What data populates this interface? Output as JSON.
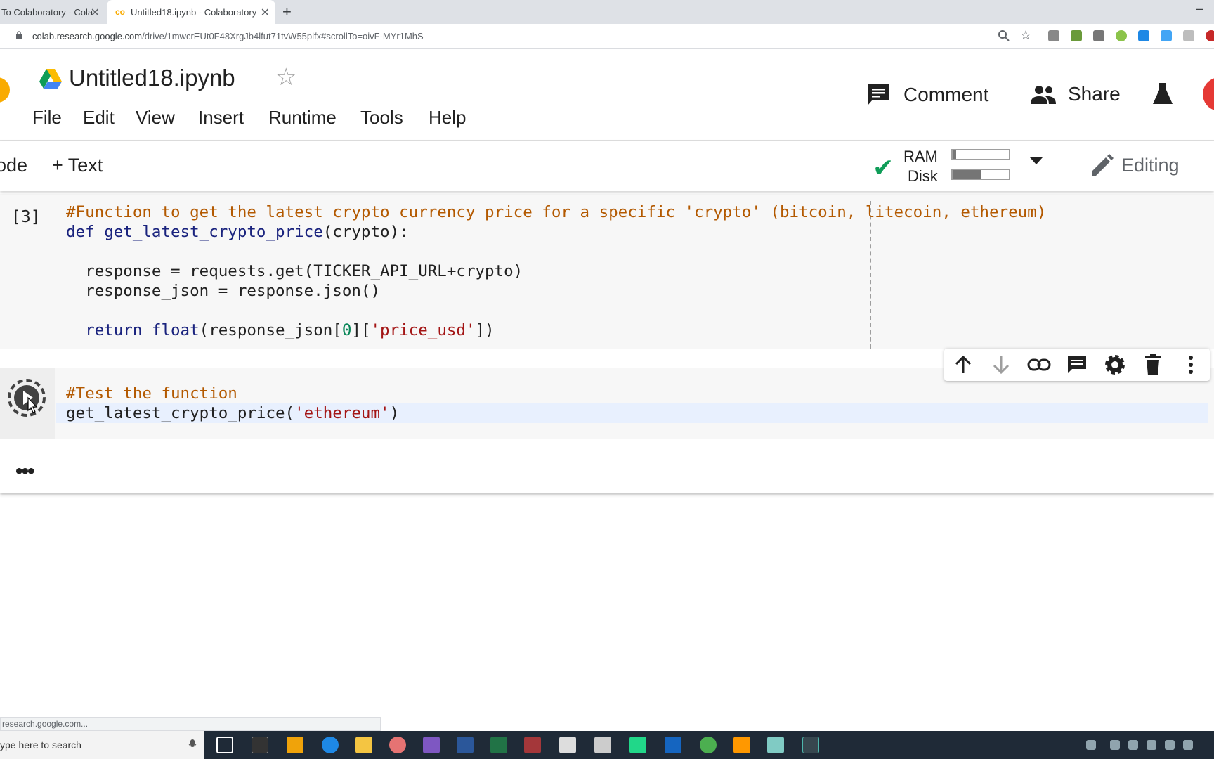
{
  "browser": {
    "tabs": [
      {
        "title": "To Colaboratory - Cola"
      },
      {
        "title": "Untitled18.ipynb - Colaboratory",
        "favicon": "co"
      }
    ],
    "url_host": "colab.research.google.com",
    "url_path": "/drive/1mwcrEUt0F48XrgJb4lfut71tvW55plfx#scrollTo=oivF-MYr1MhS",
    "new_tab_symbol": "+",
    "minimize_symbol": "–"
  },
  "header": {
    "title": "Untitled18.ipynb",
    "menu": [
      "File",
      "Edit",
      "View",
      "Insert",
      "Runtime",
      "Tools",
      "Help"
    ],
    "comment_label": "Comment",
    "share_label": "Share"
  },
  "toolbar": {
    "add_code_label": "ode",
    "add_text_label": "+ Text",
    "ram_label": "RAM",
    "disk_label": "Disk",
    "ram_usage": 0.06,
    "disk_usage": 0.5,
    "editing_label": "Editing"
  },
  "cells": {
    "cell1": {
      "exec_count": "[3]",
      "line1_comment": "#Function to get the latest crypto currency price for a specific 'crypto' (bitcoin, litecoin, ethereum)",
      "line2_kw": "def",
      "line2_fn": "get_latest_crypto_price",
      "line2_rest": "(crypto):",
      "line4": "  response = requests.get(TICKER_API_URL+crypto)",
      "line5": "  response_json = response.json()",
      "line7_kw": "  return",
      "line7_bi": "float",
      "line7_a": "(response_json[",
      "line7_num": "0",
      "line7_b": "][",
      "line7_str": "'price_usd'",
      "line7_c": "])"
    },
    "cell2": {
      "line1_comment": "#Test the function",
      "line2_a": "get_latest_crypto_price(",
      "line2_str": "'ethereum'",
      "line2_b": ")"
    },
    "output_ellipsis": "•••"
  },
  "status_url": "research.google.com...",
  "taskbar": {
    "search_placeholder": "ype here to search"
  },
  "colors": {
    "accent": "#f9ab00",
    "check": "#0f9d58",
    "comment": "#b35900",
    "string": "#a31515"
  }
}
